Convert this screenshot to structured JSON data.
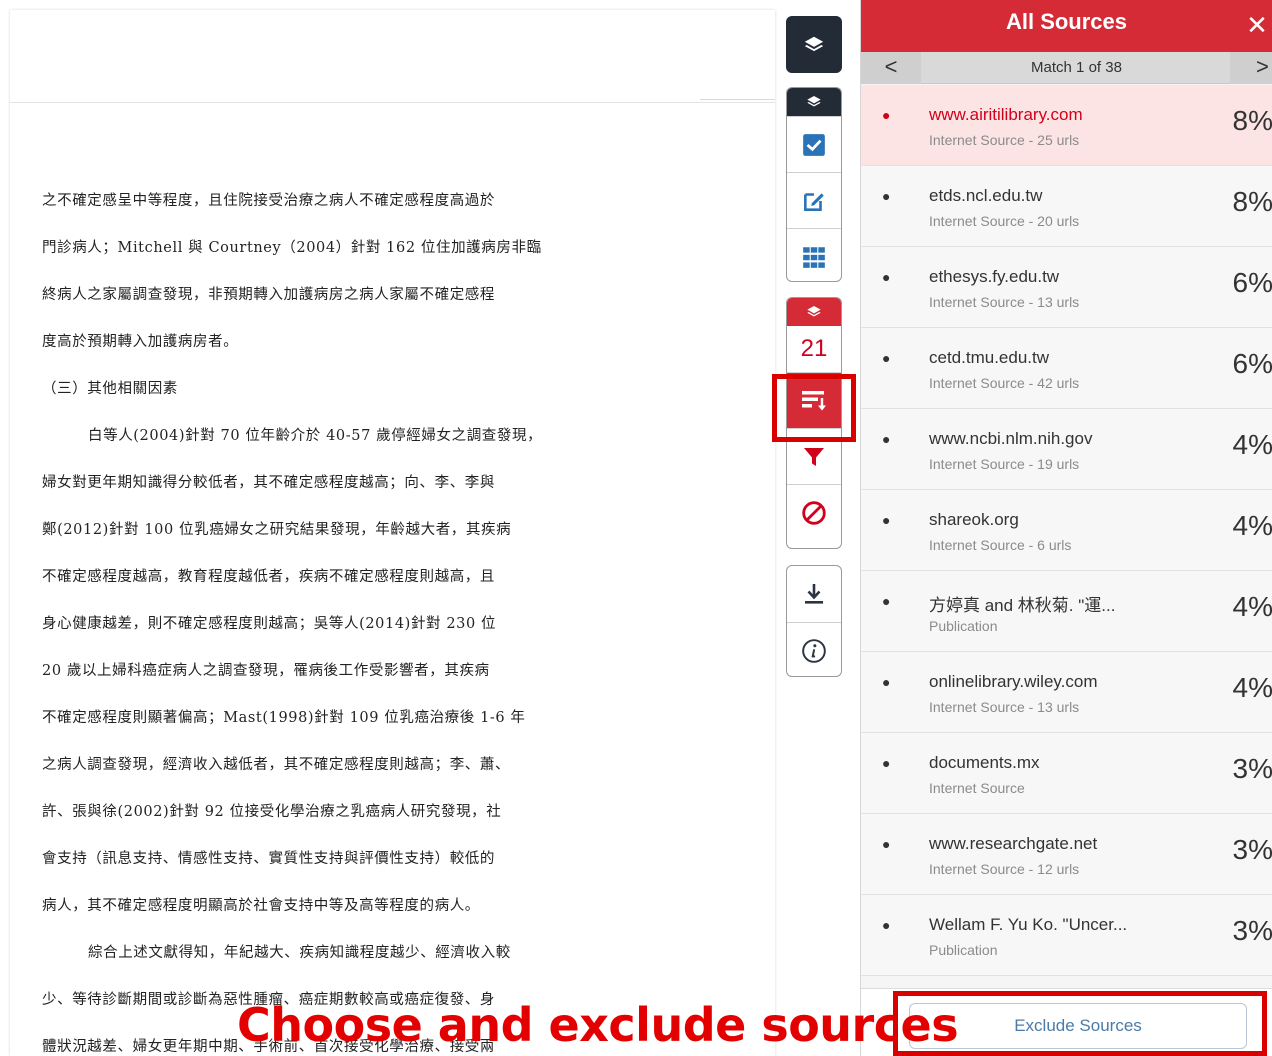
{
  "document": {
    "lines": [
      {
        "text": "之不確定感呈中等程度，且住院接受治療之病人不確定感程度高過於",
        "indent": false
      },
      {
        "text": "門診病人；Mitchell 與 Courtney（2004）針對 162 位住加護病房非臨",
        "indent": false
      },
      {
        "text": "終病人之家屬調查發現，非預期轉入加護病房之病人家屬不確定感程",
        "indent": false
      },
      {
        "text": "度高於預期轉入加護病房者。",
        "indent": false
      },
      {
        "text": "（三）其他相關因素",
        "indent": false
      },
      {
        "text": "白等人(2004)針對 70 位年齡介於 40-57 歲停經婦女之調查發現，",
        "indent": true
      },
      {
        "text": "婦女對更年期知識得分較低者，其不確定感程度越高；向、李、李與",
        "indent": false
      },
      {
        "text": "鄭(2012)針對 100 位乳癌婦女之研究結果發現，年齡越大者，其疾病",
        "indent": false
      },
      {
        "text": "不確定感程度越高，教育程度越低者，疾病不確定感程度則越高，且",
        "indent": false
      },
      {
        "text": "身心健康越差，則不確定感程度則越高；吳等人(2014)針對 230 位",
        "indent": false
      },
      {
        "text": "20 歲以上婦科癌症病人之調查發現，罹病後工作受影響者，其疾病",
        "indent": false
      },
      {
        "text": "不確定感程度則顯著偏高；Mast(1998)針對 109 位乳癌治療後 1-6 年",
        "indent": false
      },
      {
        "text": "之病人調查發現，經濟收入越低者，其不確定感程度則越高；李、蕭、",
        "indent": false
      },
      {
        "text": "許、張與徐(2002)針對 92 位接受化學治療之乳癌病人研究發現，社",
        "indent": false
      },
      {
        "text": "會支持（訊息支持、情感性支持、實質性支持與評價性支持）較低的",
        "indent": false
      },
      {
        "text": "病人，其不確定感程度明顯高於社會支持中等及高等程度的病人。",
        "indent": false
      },
      {
        "text": "綜合上述文獻得知，年紀越大、疾病知識程度越少、經濟收入較",
        "indent": true
      },
      {
        "text": "少、等待診斷期間或診斷為惡性腫瘤、癌症期數較高或癌症復發、身",
        "indent": false
      },
      {
        "text": "體狀況越差、婦女更年期中期、手術前、首次接受化學治療、接受兩",
        "indent": false
      }
    ]
  },
  "rail": {
    "match_count": "21"
  },
  "panel": {
    "title": "All Sources",
    "close": "✕",
    "prev": "<",
    "next": ">",
    "match_text": "Match 1 of 38",
    "sources": [
      {
        "name": "www.airitilibrary.com",
        "type": "Internet Source - 25 urls",
        "pct": "8%",
        "active": true
      },
      {
        "name": "etds.ncl.edu.tw",
        "type": "Internet Source - 20 urls",
        "pct": "8%",
        "active": false
      },
      {
        "name": "ethesys.fy.edu.tw",
        "type": "Internet Source - 13 urls",
        "pct": "6%",
        "active": false
      },
      {
        "name": "cetd.tmu.edu.tw",
        "type": "Internet Source - 42 urls",
        "pct": "6%",
        "active": false
      },
      {
        "name": "www.ncbi.nlm.nih.gov",
        "type": "Internet Source - 19 urls",
        "pct": "4%",
        "active": false
      },
      {
        "name": "shareok.org",
        "type": "Internet Source - 6 urls",
        "pct": "4%",
        "active": false
      },
      {
        "name": "方婷真 and 林秋菊. \"運...",
        "type": "Publication",
        "pct": "4%",
        "active": false
      },
      {
        "name": "onlinelibrary.wiley.com",
        "type": "Internet Source - 13 urls",
        "pct": "4%",
        "active": false
      },
      {
        "name": "documents.mx",
        "type": "Internet Source",
        "pct": "3%",
        "active": false
      },
      {
        "name": "www.researchgate.net",
        "type": "Internet Source - 12 urls",
        "pct": "3%",
        "active": false
      },
      {
        "name": "Wellam F. Yu Ko. \"Uncer...",
        "type": "Publication",
        "pct": "3%",
        "active": false
      }
    ],
    "exclude_label": "Exclude Sources"
  },
  "caption": "Choose and exclude sources",
  "colors": {
    "accent_red": "#d52b36",
    "dark_rail": "#222b36",
    "active_row": "#fce4e4",
    "link_blue": "#4a7ba7",
    "annotation_red": "#e30000"
  }
}
